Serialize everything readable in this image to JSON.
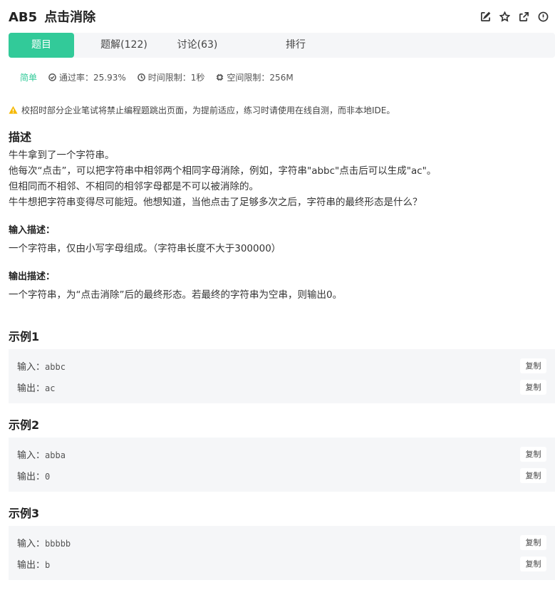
{
  "header": {
    "problem_id": "AB5",
    "problem_title": "点击消除",
    "icons": [
      "edit-icon",
      "star-icon",
      "share-icon",
      "report-icon"
    ]
  },
  "tabs": [
    {
      "label": "题目",
      "active": true
    },
    {
      "label": "题解(122)",
      "active": false
    },
    {
      "label": "讨论(63)",
      "active": false
    },
    {
      "label": "排行",
      "active": false
    }
  ],
  "meta": {
    "difficulty": "简单",
    "pass_rate": "通过率：25.93%",
    "time_limit": "时间限制：1秒",
    "memory_limit": "空间限制：256M"
  },
  "notice": "校招时部分企业笔试将禁止编程题跳出页面，为提前适应，练习时请使用在线自测，而非本地IDE。",
  "description": {
    "heading": "描述",
    "lines": [
      "牛牛拿到了一个字符串。",
      "他每次“点击”，可以把字符串中相邻两个相同字母消除，例如，字符串\"abbc\"点击后可以生成\"ac\"。",
      "但相同而不相邻、不相同的相邻字母都是不可以被消除的。",
      "牛牛想把字符串变得尽可能短。他想知道，当他点击了足够多次之后，字符串的最终形态是什么？"
    ]
  },
  "input_desc": {
    "heading": "输入描述：",
    "text": "一个字符串，仅由小写字母组成。（字符串长度不大于300000）"
  },
  "output_desc": {
    "heading": "输出描述：",
    "text": "一个字符串，为“点击消除”后的最终形态。若最终的字符串为空串，则输出0。"
  },
  "examples": [
    {
      "heading": "示例1",
      "input_label": "输入：",
      "input": "abbc",
      "output_label": "输出：",
      "output": "ac",
      "copy_label": "复制"
    },
    {
      "heading": "示例2",
      "input_label": "输入：",
      "input": "abba",
      "output_label": "输出：",
      "output": "0",
      "copy_label": "复制"
    },
    {
      "heading": "示例3",
      "input_label": "输入：",
      "input": "bbbbb",
      "output_label": "输出：",
      "output": "b",
      "copy_label": "复制"
    }
  ]
}
